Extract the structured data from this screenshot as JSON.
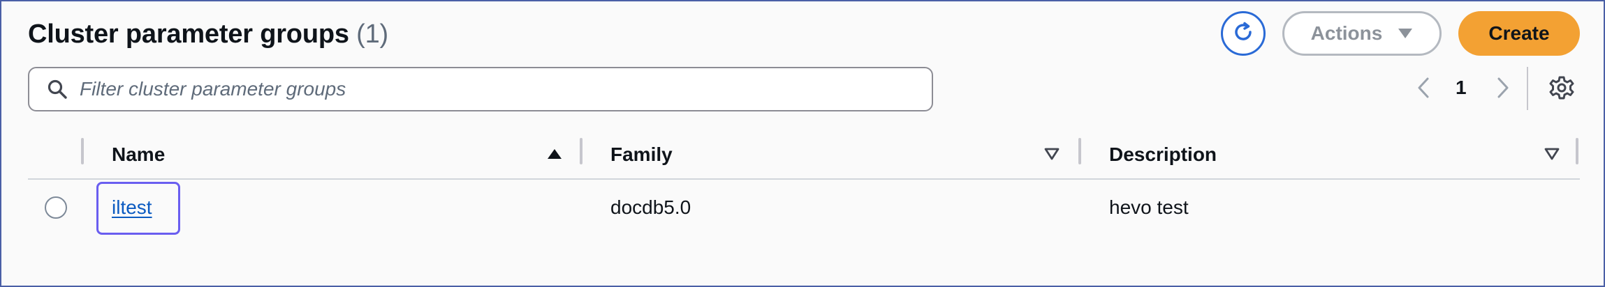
{
  "header": {
    "title": "Cluster parameter groups",
    "count": "(1)",
    "actions_label": "Actions",
    "create_label": "Create"
  },
  "search": {
    "placeholder": "Filter cluster parameter groups"
  },
  "pagination": {
    "current_page": "1"
  },
  "table": {
    "columns": [
      {
        "label": "Name",
        "sort": "ascending"
      },
      {
        "label": "Family",
        "sort": "none"
      },
      {
        "label": "Description",
        "sort": "none"
      }
    ],
    "rows": [
      {
        "name": "iltest",
        "family": "docdb5.0",
        "description": "hevo test",
        "selected": false
      }
    ]
  },
  "icons": {
    "refresh": "refresh-icon",
    "caret": "caret-down-icon",
    "search": "search-icon",
    "prev": "chevron-left-icon",
    "next": "chevron-right-icon",
    "settings": "gear-icon",
    "sort_asc": "sort-ascending-icon",
    "sort_none": "sort-descending-outline-icon"
  },
  "colors": {
    "primary": "#f3a133",
    "link": "#0b5bc1",
    "focus": "#6a5ef0",
    "refresh": "#2a6ad6",
    "frame": "#4a5fa6"
  }
}
